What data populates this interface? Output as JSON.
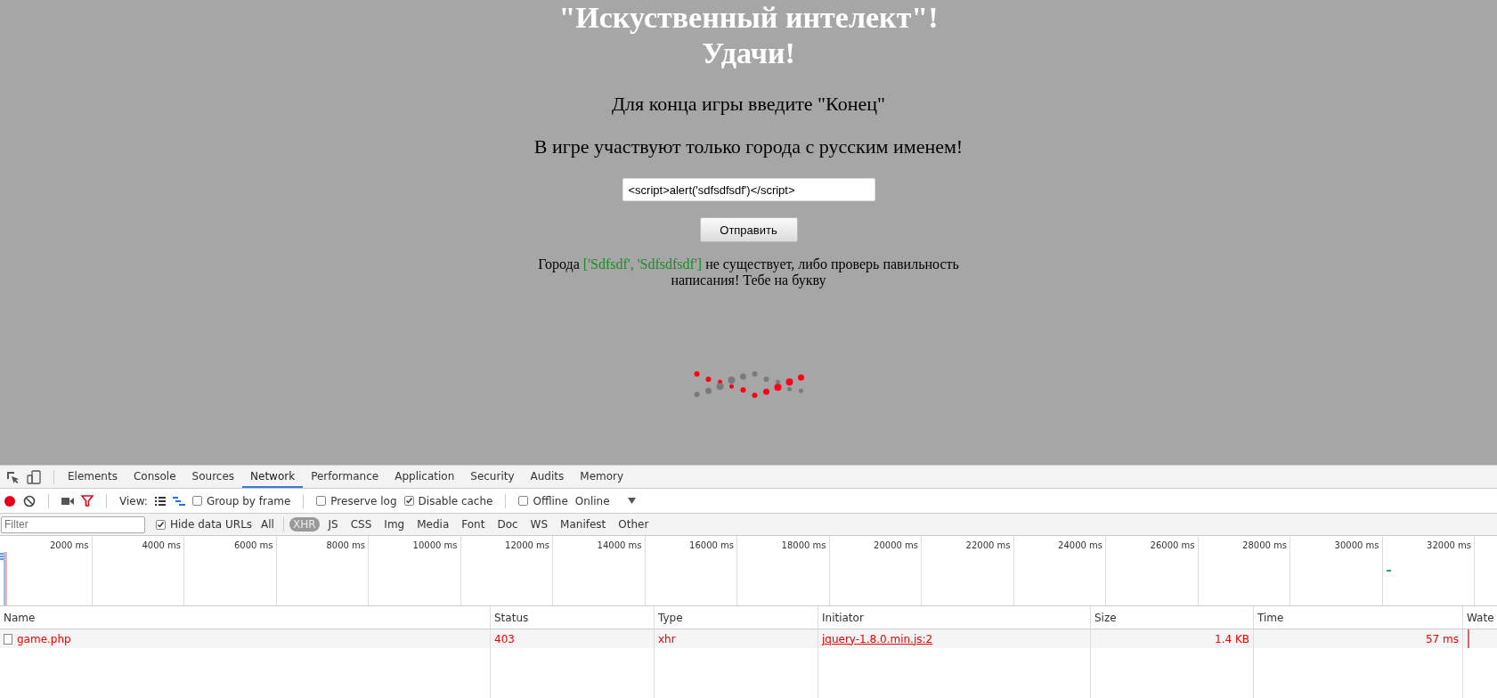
{
  "page": {
    "title_lines": [
      "\"Искуственный интелект\"!",
      "Удачи!"
    ],
    "instructions": [
      "Для конца игры введите \"Конец\"",
      "В игре участвуют только города с русским именем!"
    ],
    "city_input": {
      "value": "<script>alert('sdfsdfsdf')</script>"
    },
    "submit_button": "Отправить",
    "message": {
      "before": "Города ",
      "highlight": "['Sdfsdf', 'Sdfsdfsdf']",
      "after": " не существует, либо проверь павильность написания! Тебе на букву"
    }
  },
  "devtools": {
    "tabs": [
      {
        "label": "Elements",
        "selected": false
      },
      {
        "label": "Console",
        "selected": false
      },
      {
        "label": "Sources",
        "selected": false
      },
      {
        "label": "Network",
        "selected": true
      },
      {
        "label": "Performance",
        "selected": false
      },
      {
        "label": "Application",
        "selected": false
      },
      {
        "label": "Security",
        "selected": false
      },
      {
        "label": "Audits",
        "selected": false
      },
      {
        "label": "Memory",
        "selected": false
      }
    ],
    "toolbar": {
      "view_label": "View:",
      "checkboxes": [
        {
          "label": "Group by frame",
          "checked": false
        },
        {
          "label": "Preserve log",
          "checked": false
        },
        {
          "label": "Disable cache",
          "checked": true
        },
        {
          "label": "Offline",
          "checked": false
        }
      ],
      "throttle": "Online"
    },
    "filter_bar": {
      "placeholder": "Filter",
      "hide_data_urls": {
        "label": "Hide data URLs",
        "checked": true
      },
      "types": [
        {
          "label": "All",
          "selected": false
        },
        {
          "label": "XHR",
          "selected": true
        },
        {
          "label": "JS",
          "selected": false
        },
        {
          "label": "CSS",
          "selected": false
        },
        {
          "label": "Img",
          "selected": false
        },
        {
          "label": "Media",
          "selected": false
        },
        {
          "label": "Font",
          "selected": false
        },
        {
          "label": "Doc",
          "selected": false
        },
        {
          "label": "WS",
          "selected": false
        },
        {
          "label": "Manifest",
          "selected": false
        },
        {
          "label": "Other",
          "selected": false
        }
      ]
    },
    "timeline_ticks": [
      "2000 ms",
      "4000 ms",
      "6000 ms",
      "8000 ms",
      "10000 ms",
      "12000 ms",
      "14000 ms",
      "16000 ms",
      "18000 ms",
      "20000 ms",
      "22000 ms",
      "24000 ms",
      "26000 ms",
      "28000 ms",
      "30000 ms",
      "32000 ms"
    ],
    "table": {
      "columns": [
        "Name",
        "Status",
        "Type",
        "Initiator",
        "Size",
        "Time",
        "Wate"
      ],
      "rows": [
        {
          "name": "game.php",
          "status": "403",
          "type": "xhr",
          "initiator": "jquery-1.8.0.min.js:2",
          "size": "1.4 KB",
          "time": "57 ms",
          "error": true
        }
      ]
    }
  }
}
